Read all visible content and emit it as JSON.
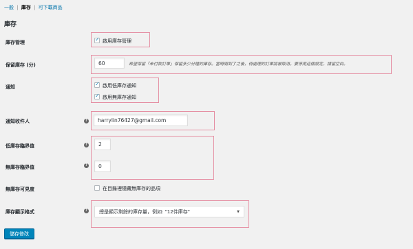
{
  "subnav": {
    "general": "一般",
    "inventory": "庫存",
    "downloadable": "可下載商品",
    "sep": "|"
  },
  "section_title": "庫存",
  "rows": {
    "manage_stock": {
      "label": "庫存管理",
      "checkbox_label": "啟用庫存管理",
      "checked": true
    },
    "hold_stock": {
      "label": "保留庫存 (分)",
      "value": "60",
      "description": "希望保留「未付款訂單」保留多少分鐘的庫存。當時間到了之後，待處理的訂單將被取消。要停用這個設定，請留空白。"
    },
    "notifications": {
      "label": "通知",
      "low_stock_label": "啟用低庫存通知",
      "out_of_stock_label": "啟用無庫存通知",
      "low_checked": true,
      "out_checked": true
    },
    "recipient": {
      "label": "通知收件人",
      "value": "harrylin76427@gmail.com"
    },
    "low_threshold": {
      "label": "低庫存臨界值",
      "value": "2"
    },
    "out_threshold": {
      "label": "無庫存臨界值",
      "value": "0"
    },
    "visibility": {
      "label": "無庫存可見度",
      "checkbox_label": "在目錄裡隱藏無庫存的品項",
      "checked": false
    },
    "display_format": {
      "label": "庫存顯示格式",
      "selected": "總是顯示剩餘的庫存量，例如: \"12件庫存\""
    }
  },
  "help_icon_glyph": "?",
  "caret_glyph": "▼",
  "save_button": "儲存修改",
  "colors": {
    "highlight_border": "#e58fa3",
    "button": "#0085ba",
    "link": "#0073aa"
  }
}
